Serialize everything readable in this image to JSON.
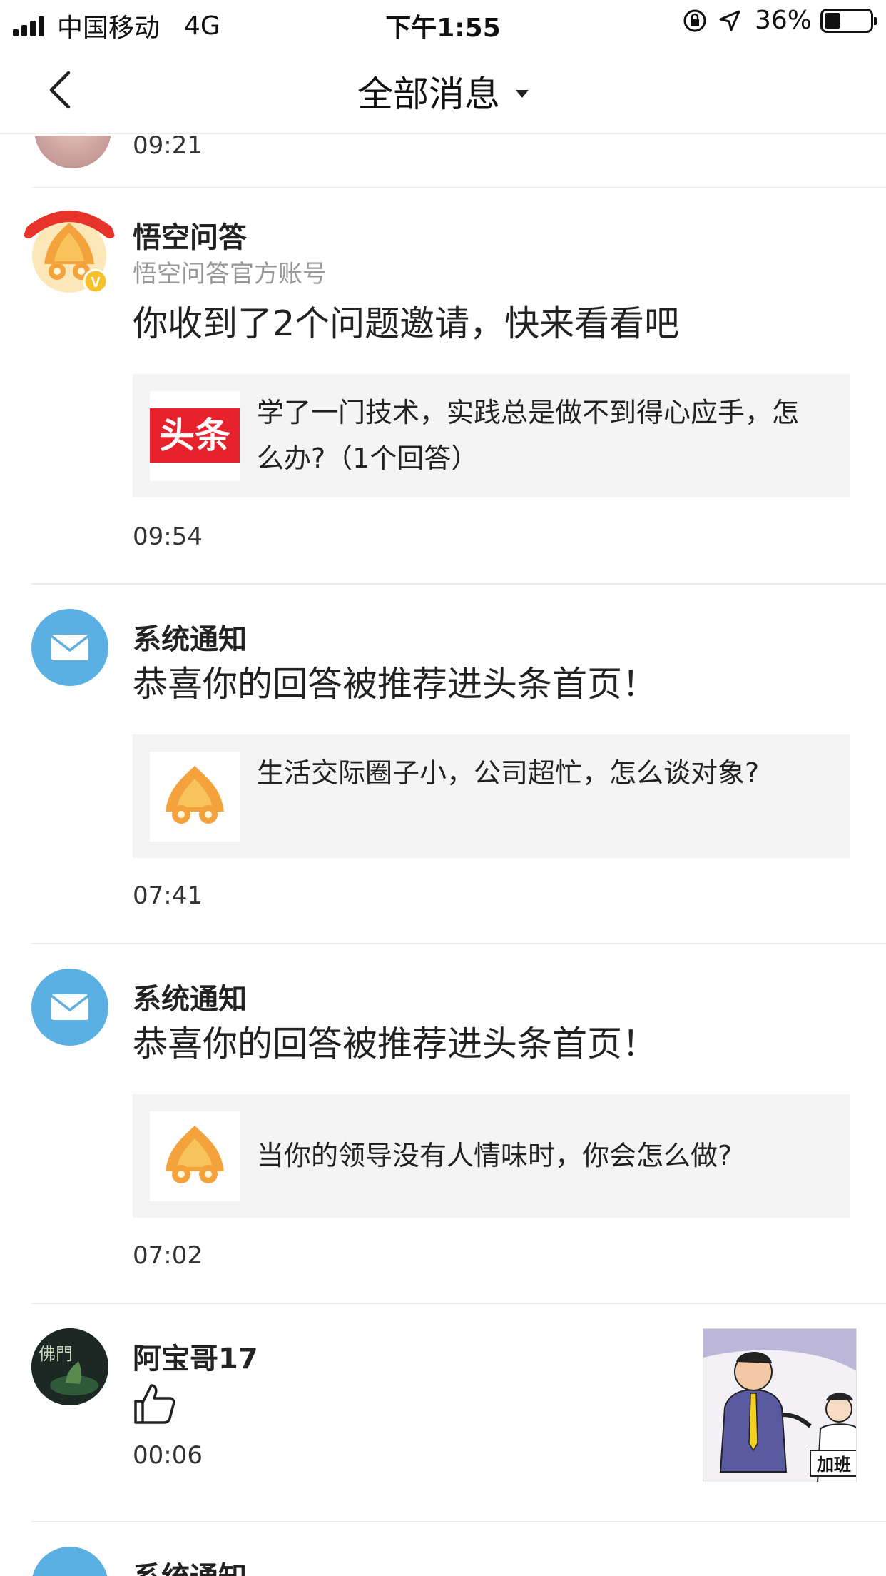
{
  "status_bar": {
    "carrier": "中国移动",
    "network": "4G",
    "time": "下午1:55",
    "battery": "36%",
    "battery_level": 0.36
  },
  "nav": {
    "title": "全部消息"
  },
  "partial_item": {
    "time": "09:21"
  },
  "messages": [
    {
      "sender": "悟空问答",
      "subtitle": "悟空问答官方账号",
      "text": "你收到了2个问题邀请，快来看看吧",
      "card_logo_text": "头条",
      "card_text": "学了一门技术，实践总是做不到得心应手，怎么办?（1个回答）",
      "time": "09:54"
    },
    {
      "sender": "系统通知",
      "text": "恭喜你的回答被推荐进头条首页！",
      "card_text": "生活交际圈子小，公司超忙，怎么谈对象?",
      "time": "07:41"
    },
    {
      "sender": "系统通知",
      "text": "恭喜你的回答被推荐进头条首页！",
      "card_text": "当你的领导没有人情味时，你会怎么做?",
      "time": "07:02"
    },
    {
      "sender": "阿宝哥17",
      "icon": "thumbs-up-icon",
      "time": "00:06",
      "avatar_text": "佛門",
      "image_text": "加班"
    },
    {
      "sender": "系统通知"
    }
  ],
  "colors": {
    "system_avatar": "#5aafe3",
    "toutiao_red": "#e8222d",
    "card_bg": "#f4f4f4",
    "divider": "#ececec"
  }
}
